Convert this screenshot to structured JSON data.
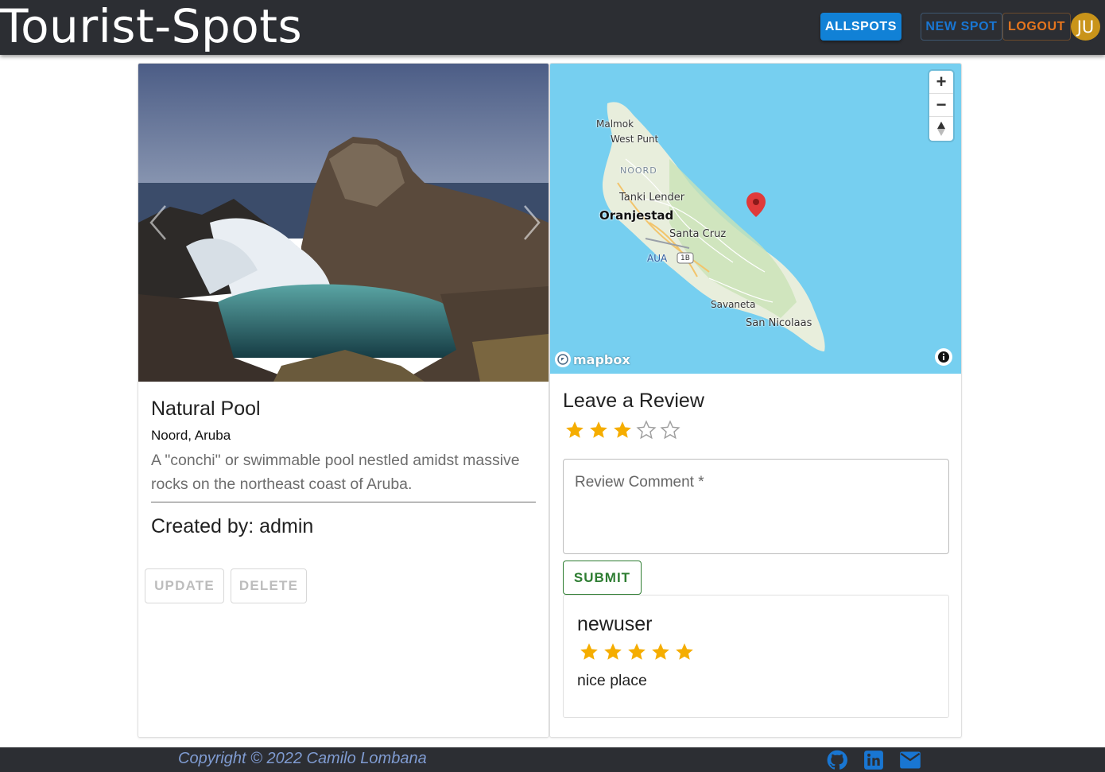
{
  "header": {
    "brand": "Tourist-Spots",
    "nav": {
      "allspots": "ALLSPOTS",
      "new_spot": "NEW SPOT",
      "logout": "LOGOUT"
    },
    "avatar_initials": "JU"
  },
  "spot": {
    "title": "Natural Pool",
    "location": "Noord, Aruba",
    "description": "A \"conchi\" or swimmable pool nestled amidst massive rocks on the northeast coast of Aruba.",
    "created_by": "Created by: admin",
    "actions": {
      "update": "UPDATE",
      "delete": "DELETE"
    }
  },
  "map": {
    "labels": {
      "malmok": "Malmok",
      "west_punt": "West Punt",
      "noord": "NOORD",
      "tanki_lender": "Tanki Lender",
      "oranjestad": "Oranjestad",
      "santa_cruz": "Santa Cruz",
      "aua": "AUA",
      "route": "1B",
      "savaneta": "Savaneta",
      "san_nicolaas": "San Nicolaas"
    },
    "attribution": "mapbox",
    "controls": {
      "zoom_in": "+",
      "zoom_out": "−"
    }
  },
  "review_form": {
    "heading": "Leave a Review",
    "rating": 3,
    "rating_max": 5,
    "comment_placeholder": "Review Comment *",
    "submit": "SUBMIT"
  },
  "reviews": [
    {
      "author": "newuser",
      "rating": 5,
      "text": "nice place"
    }
  ],
  "footer": {
    "copyright": "Copyright © 2022 Camilo Lombana"
  },
  "colors": {
    "appbar": "#2c2e33",
    "allspots": "#1181d6",
    "new_spot": "#1976d2",
    "logout": "#e6761e",
    "avatar": "#c9941a",
    "star": "#f5ad00",
    "submit": "#2e7d32",
    "map_water": "#76cff0",
    "marker": "#e03a3a"
  }
}
